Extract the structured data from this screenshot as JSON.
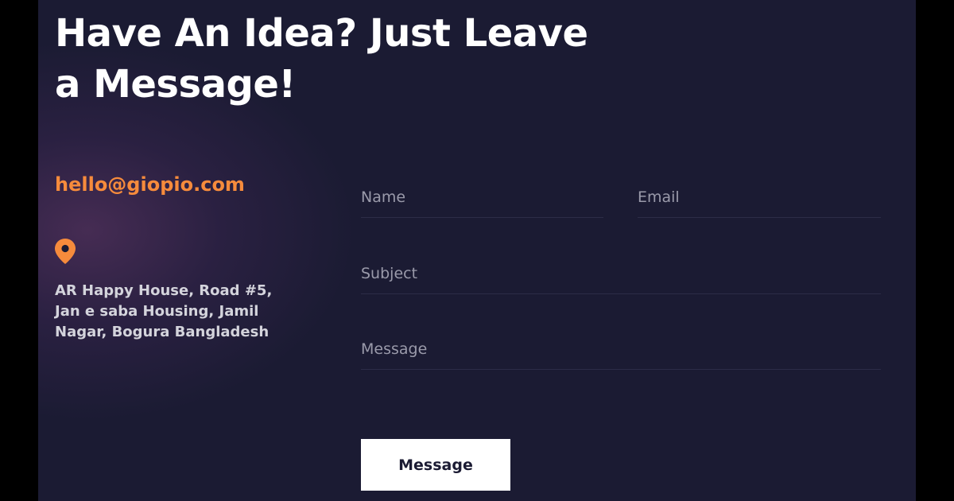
{
  "contact": {
    "headline": "Have An Idea? Just Leave a Message!",
    "email": "hello@giopio.com",
    "location_icon": "map-pin-icon",
    "address": "AR Happy House, Road #5, Jan e saba Housing, Jamil Nagar, Bogura Bangladesh"
  },
  "form": {
    "name_placeholder": "Name",
    "email_placeholder": "Email",
    "subject_placeholder": "Subject",
    "message_placeholder": "Message",
    "submit_label": "Message"
  },
  "colors": {
    "background": "#1b1b33",
    "accent": "#f68b3c",
    "button_bg": "#ffffff",
    "headline": "#ffffff"
  }
}
